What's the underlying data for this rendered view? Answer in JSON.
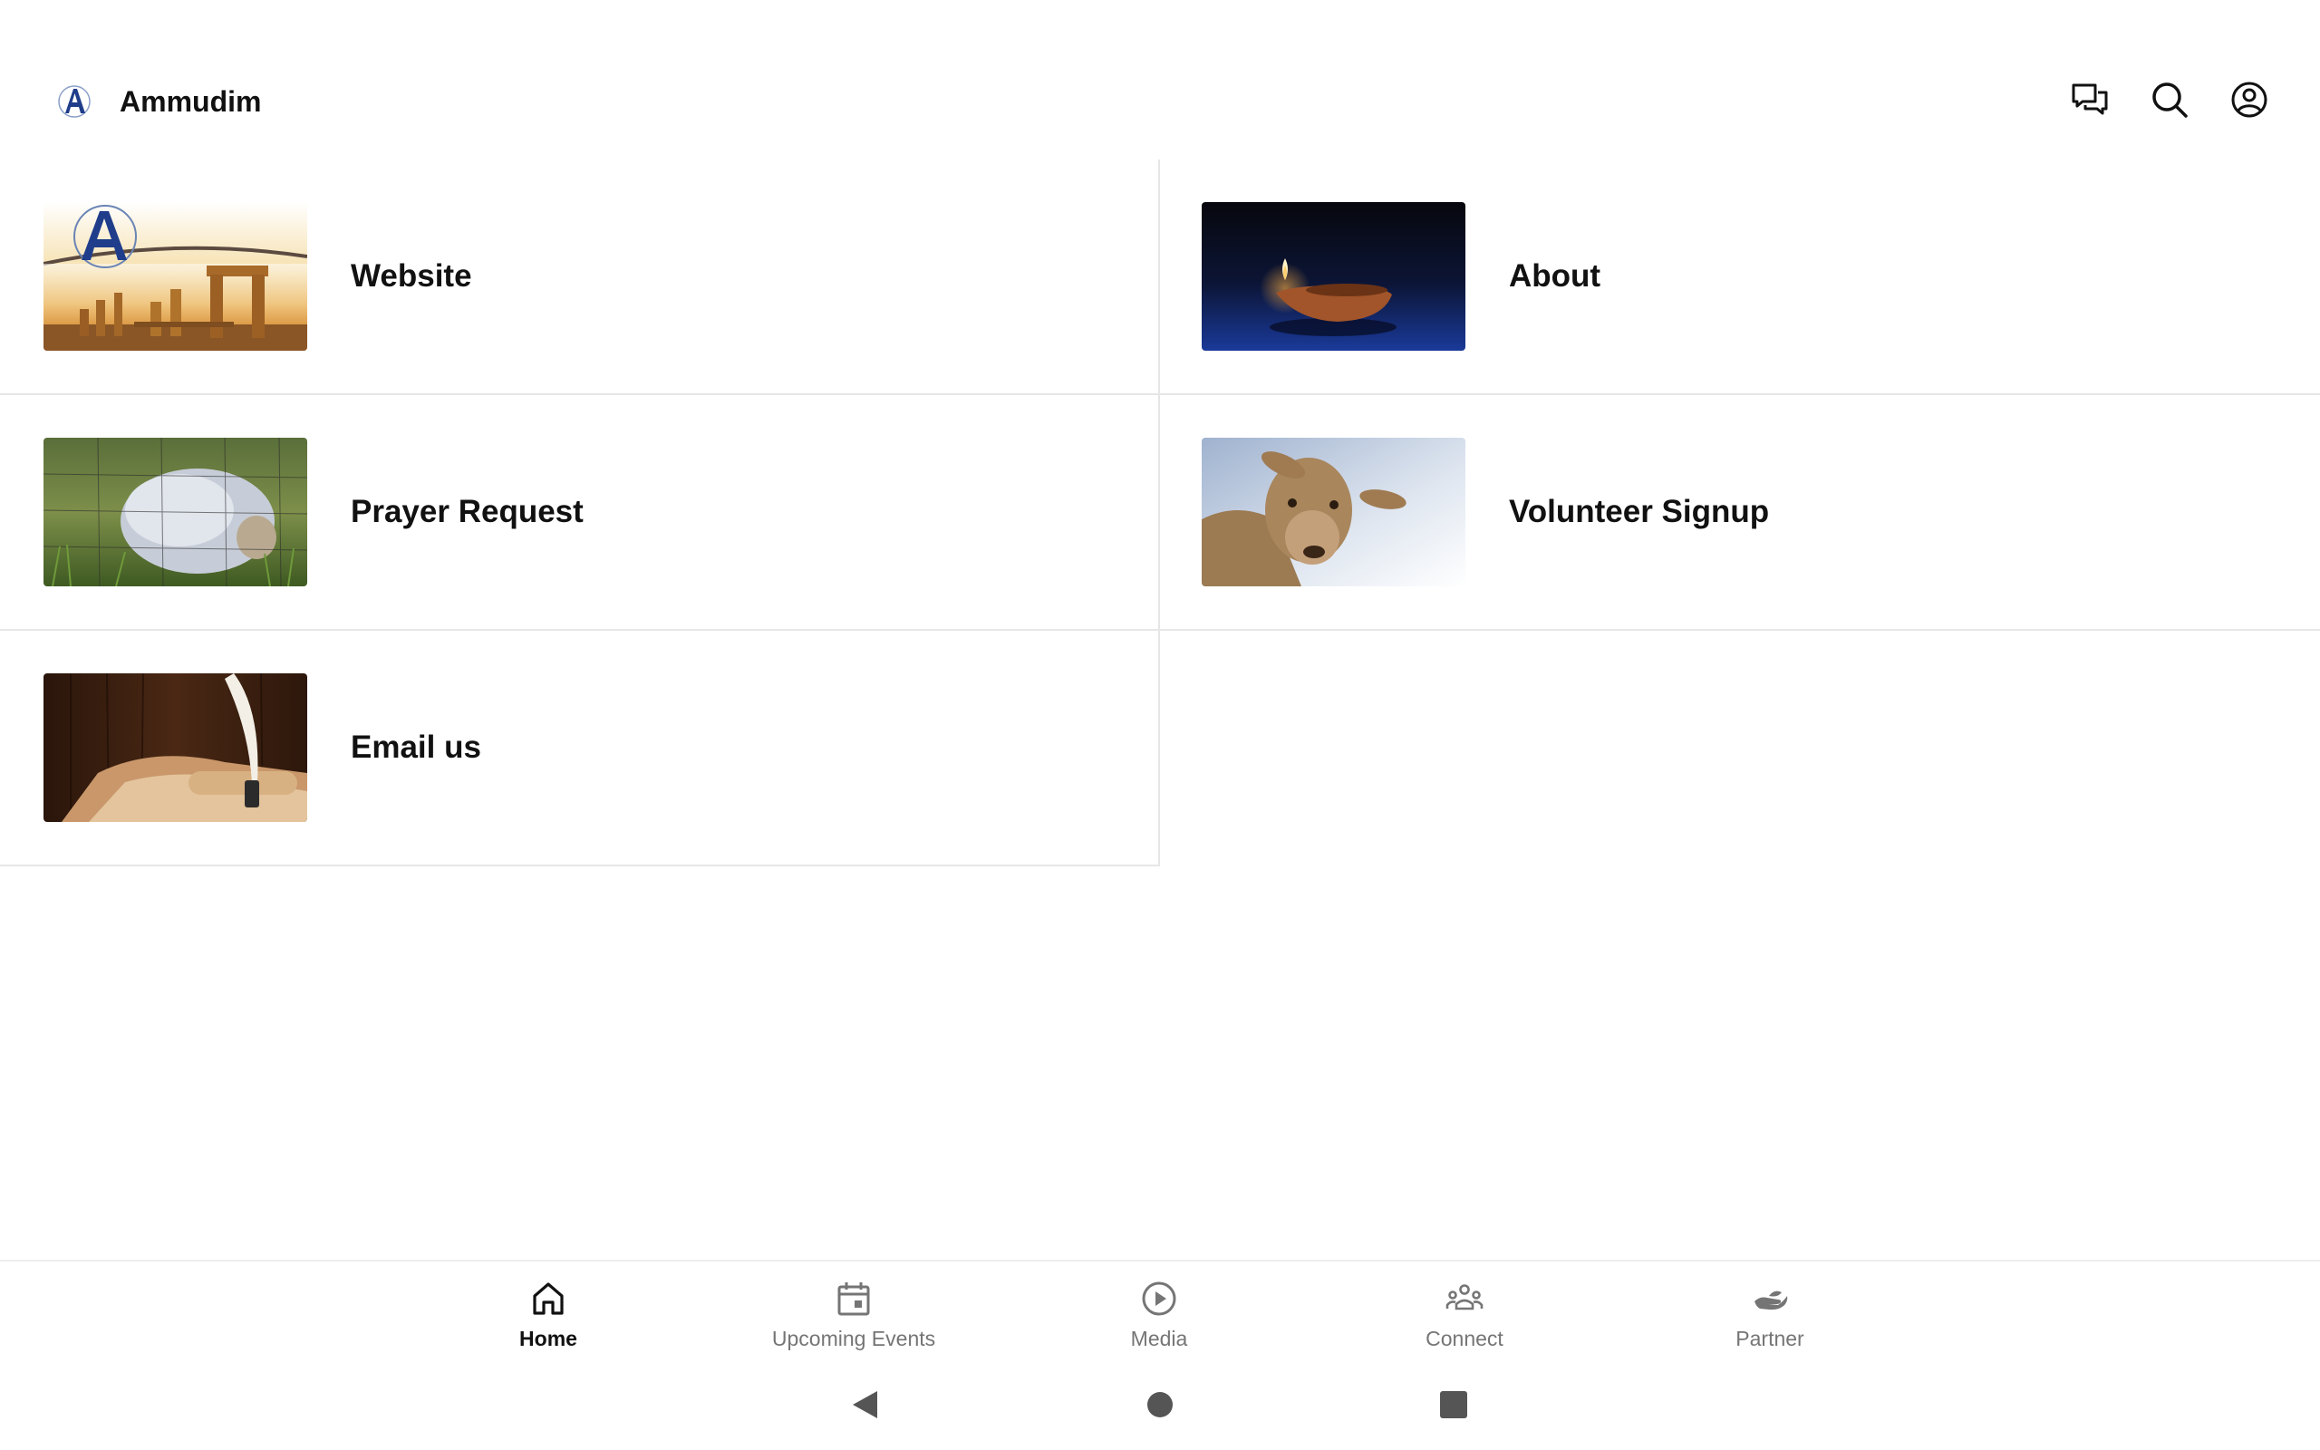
{
  "header": {
    "title": "Ammudim",
    "logo_letter": "A"
  },
  "tiles": [
    {
      "label": "Website",
      "image": "ruins-columns-sunset"
    },
    {
      "label": "About",
      "image": "oil-lamp-flame"
    },
    {
      "label": "Prayer Request",
      "image": "sheep-in-grass"
    },
    {
      "label": "Volunteer Signup",
      "image": "sheep-face-closeup"
    },
    {
      "label": "Email us",
      "image": "quill-and-scroll"
    }
  ],
  "bottom_nav": {
    "items": [
      {
        "label": "Home",
        "icon": "home-icon",
        "active": true
      },
      {
        "label": "Upcoming Events",
        "icon": "calendar-icon",
        "active": false
      },
      {
        "label": "Media",
        "icon": "play-circle-icon",
        "active": false
      },
      {
        "label": "Connect",
        "icon": "people-icon",
        "active": false
      },
      {
        "label": "Partner",
        "icon": "hand-icon",
        "active": false
      }
    ]
  },
  "colors": {
    "brand_blue": "#1f3d8a",
    "text": "#111111",
    "nav_inactive": "#757575",
    "divider": "#e6e6e6"
  }
}
